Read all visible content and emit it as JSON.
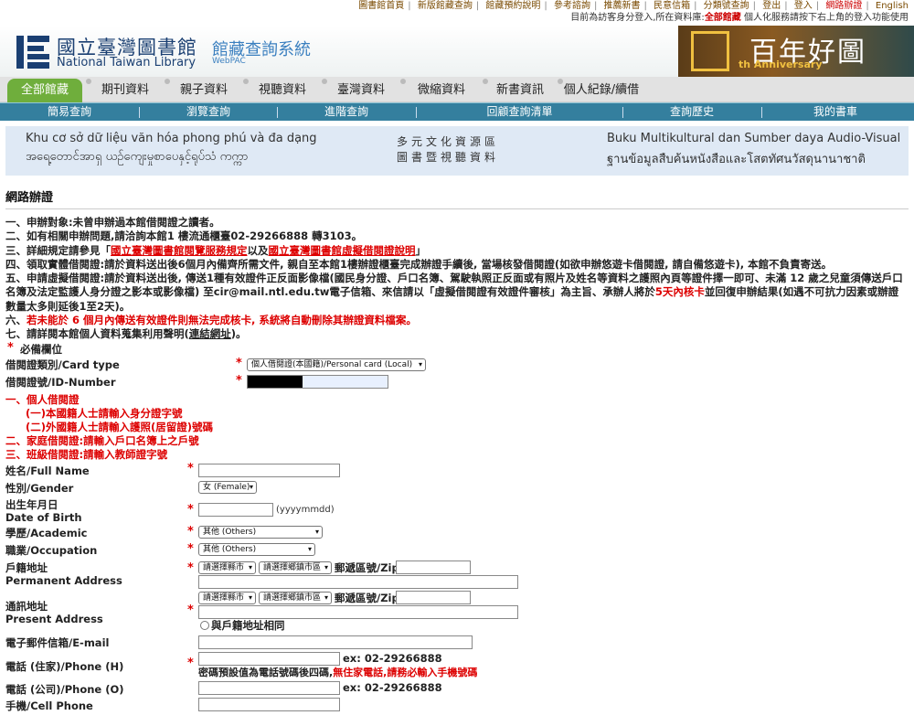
{
  "toplinks": [
    "圖書館首頁",
    "新版館藏查詢",
    "館藏預約說明",
    "參考諮詢",
    "推薦新書",
    "民意信箱",
    "分類號查詢",
    "登出",
    "登入",
    "網路辦證",
    "English"
  ],
  "visitor": {
    "before": "目前為訪客身分登入,所在資料庫:",
    "db": "全部館藏",
    "after": " 個人化服務請按下右上角的登入功能使用"
  },
  "header": {
    "lib_zh": "國立臺灣圖書館",
    "lib_en": "National Taiwan Library",
    "sys_zh": "館藏查詢系統",
    "sys_en": "WebPAC",
    "anniv_title": "百年好圖",
    "anniv_sub": "th Anniversary"
  },
  "tabs": [
    "全部館藏",
    "期刊資料",
    "親子資料",
    "視聽資料",
    "臺灣資料",
    "微縮資料",
    "新書資訊",
    "個人紀錄/續借"
  ],
  "subnav": [
    "簡易查詢",
    "瀏覽查詢",
    "進階查詢",
    "回顧查詢清單",
    "查詢歷史",
    "我的書車"
  ],
  "multicultural": {
    "vi": "Khu cơ sở dữ liệu văn hóa phong phú và đa dạng",
    "my": "အရေ့တောင်အာရှ ယဉ်ကျေးမှုစာပေနှင့်ရုပ်သံ ကက္ကာ",
    "zh1": "多元文化資源區",
    "zh2": "圖書暨視聽資料",
    "id": "Buku Multikultural dan Sumber daya Audio-Visual",
    "th": "ฐานข้อมูลสืบค้นหนังสือและโสตทัศนวัสดุนานาชาติ"
  },
  "page_title": "網路辦證",
  "notes": {
    "n1": "一、申辦對象:未曾申辦過本館借閱證之讀者。",
    "n2": "二、如有相關申辦問題,請洽詢本館1 樓流通櫃臺02-29266888 轉3103。",
    "n3a": "三、詳細規定請參見「",
    "n3b": "國立臺灣圖書館閱覽服務規定",
    "n3c": "以及",
    "n3d": "國立臺灣圖書館虛擬借閱證說明",
    "n3e": "」",
    "n4": "四、領取實體借閱證:請於資料送出後6個月內備齊所需文件, 親自至本館1樓辦證櫃臺完成辦證手續後, 當場核發借閱證(如欲申辦悠遊卡借閱證, 請自備悠遊卡), 本館不負責寄送。",
    "n5a": "五、申請虛擬借閱證:請於資料送出後, 傳送1種有效證件正反面影像檔(國民身分證、戶口名簿、駕駛執照正反面或有照片及姓名等資料之護照內頁等證件擇一即可、未滿 12 歲之兒童須傳送戶口名簿及法定監護人身分證之影本或影像檔) 至cir@mail.ntl.edu.tw電子信箱、來信請以「虛擬借閱證有效證件審核」為主旨、承辦人將於",
    "n5b": "5天內核卡",
    "n5c": "並回復申辦結果(如遇不可抗力因素或辦證數量太多則延後1至2天)。",
    "n6a": "六、",
    "n6b": "若未能於 6 個月內傳送有效證件則無法完成核卡, 系統將自動刪除其辦證資料檔案。",
    "n7a": "七、請詳閱本館個人資料蒐集利用聲明(",
    "n7b": "連結網址",
    "n7c": ")。"
  },
  "required_note": "必備欄位",
  "form": {
    "card_type_label": "借閱證類別/Card type",
    "card_type_value": "個人借閱證(本國籍)/Personal card (Local)",
    "id_label": "借閱證號/ID-Number",
    "personal_card": "一、個人借閱證",
    "local_hint": "(一)本國籍人士請輸入身分證字號",
    "foreign_hint": "(二)外國籍人士請輸入護照(居留證)號碼",
    "family_card": "二、家庭借閱證:請輸入戶口名簿上之戶號",
    "class_card": "三、班級借閱證:請輸入教師證字號",
    "name_label": "姓名/Full Name",
    "gender_label": "性別/Gender",
    "gender_value": "女 (Female)",
    "dob_label1": "出生年月日",
    "dob_label2": "Date of Birth",
    "dob_hint": "(yyyymmdd)",
    "edu_label": "學歷/Academic",
    "edu_value": "其他 (Others)",
    "occ_label": "職業/Occupation",
    "occ_value": "其他 (Others)",
    "perm_label1": "戶籍地址",
    "perm_label2": "Permanent Address",
    "county": "請選擇縣市",
    "district": "請選擇鄉鎮市區",
    "zip_label": "郵遞區號/Zip",
    "present_label1": "通訊地址",
    "present_label2": "Present Address",
    "same_label": "與戶籍地址相同",
    "email_label": "電子郵件信箱/E-mail",
    "phone_h_label": "電話 (住家)/Phone (H)",
    "phone_ex": "ex: 02-29266888",
    "pw_hint_a": "密碼預設值為電話號碼後四碼,",
    "pw_hint_b": "無住家電話,請務必輸入手機號碼",
    "phone_o_label": "電話 (公司)/Phone (O)",
    "cell_label": "手機/Cell Phone"
  },
  "colors": {
    "accent_green": "#6fae3c",
    "nav_blue": "#347f9e",
    "required_red": "#dd0000",
    "brand_navy": "#1a3f72"
  }
}
